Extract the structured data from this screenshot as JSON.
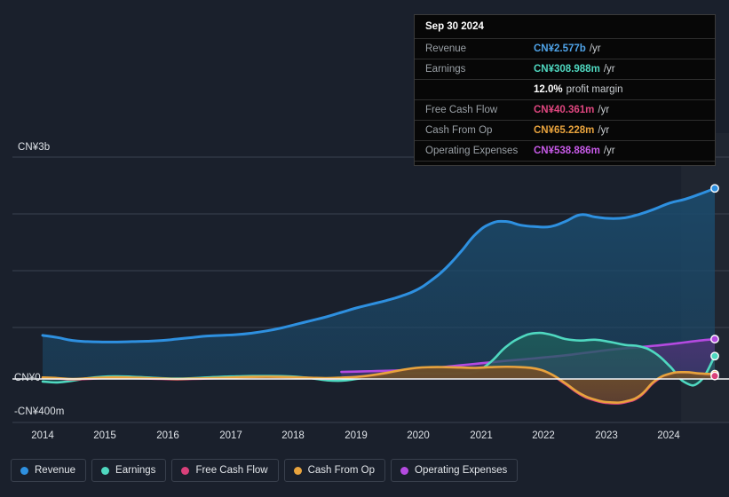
{
  "chart_data": {
    "type": "area",
    "title": "",
    "xlabel": "",
    "ylabel": "",
    "currency": "CN¥",
    "grid": true,
    "legend_position": "bottom",
    "x": [
      2014,
      2015,
      2016,
      2017,
      2018,
      2019,
      2020,
      2021,
      2022,
      2023,
      2024
    ],
    "xlim": [
      2013.7,
      2024.85
    ],
    "ylim": [
      -400000000,
      3000000000
    ],
    "y_ticks": [
      {
        "label": "CN¥3b",
        "value": 3000000000
      },
      {
        "label": "CN¥0",
        "value": 0
      },
      {
        "label": "-CN¥400m",
        "value": -400000000
      }
    ],
    "x_ticks": [
      "2014",
      "2015",
      "2016",
      "2017",
      "2018",
      "2019",
      "2020",
      "2021",
      "2022",
      "2023",
      "2024"
    ],
    "series": [
      {
        "name": "Revenue",
        "color": "#2e90e0",
        "fill": "#1b4a6b",
        "values": [
          590,
          560,
          520,
          505,
          500,
          500,
          505,
          510,
          520,
          540,
          560,
          580,
          590,
          600,
          620,
          650,
          690,
          740,
          790,
          840,
          900,
          960,
          1010,
          1060,
          1120,
          1200,
          1330,
          1500,
          1720,
          1960,
          2100,
          2130,
          2080,
          2060,
          2060,
          2130,
          2220,
          2190,
          2170,
          2180,
          2230,
          2300,
          2380,
          2430,
          2500,
          2577
        ]
      },
      {
        "name": "Earnings",
        "color": "#4fd8c0",
        "fill": "#1f5b5a",
        "values": [
          -30,
          -40,
          -20,
          10,
          30,
          35,
          30,
          20,
          10,
          5,
          10,
          20,
          30,
          35,
          40,
          40,
          38,
          30,
          10,
          -15,
          -20,
          0,
          30,
          60,
          75,
          80,
          78,
          75,
          80,
          100,
          230,
          430,
          560,
          620,
          600,
          540,
          520,
          530,
          500,
          460,
          440,
          350,
          170,
          -40,
          -30,
          309
        ]
      },
      {
        "name": "Free Cash Flow",
        "color": "#d9407a",
        "fill": "#6b2d4c",
        "values": [
          10,
          5,
          -5,
          0,
          10,
          15,
          10,
          5,
          0,
          -5,
          0,
          5,
          10,
          15,
          20,
          22,
          20,
          15,
          10,
          5,
          10,
          20,
          40,
          70,
          110,
          140,
          150,
          150,
          145,
          140,
          150,
          155,
          150,
          130,
          60,
          -60,
          -180,
          -250,
          -280,
          -270,
          -200,
          -30,
          60,
          80,
          60,
          40
        ]
      },
      {
        "name": "Cash From Op",
        "color": "#e8a33d",
        "fill": "#6b5226",
        "values": [
          20,
          12,
          0,
          8,
          18,
          22,
          18,
          12,
          6,
          0,
          5,
          10,
          16,
          22,
          28,
          30,
          28,
          22,
          16,
          12,
          18,
          28,
          50,
          82,
          120,
          150,
          160,
          160,
          155,
          150,
          160,
          165,
          160,
          140,
          70,
          -50,
          -170,
          -240,
          -270,
          -260,
          -190,
          -20,
          72,
          92,
          74,
          65
        ]
      },
      {
        "name": "Operating Expenses",
        "color": "#b44ae0",
        "fill": "#4b3474",
        "start_index": 20,
        "values": [
          null,
          null,
          null,
          null,
          null,
          null,
          null,
          null,
          null,
          null,
          null,
          null,
          null,
          null,
          null,
          null,
          null,
          null,
          null,
          null,
          95,
          100,
          105,
          110,
          118,
          130,
          148,
          165,
          185,
          205,
          225,
          245,
          262,
          280,
          300,
          320,
          345,
          370,
          395,
          415,
          430,
          450,
          470,
          495,
          520,
          539
        ]
      }
    ],
    "highlight_band": {
      "from": 2023.5,
      "label": ""
    },
    "end_markers": [
      {
        "series": "Revenue",
        "value": 2577000000
      },
      {
        "series": "Operating Expenses",
        "value": 538886000
      },
      {
        "series": "Earnings",
        "value": 308988000
      },
      {
        "series": "Cash From Op",
        "value": 65228000
      },
      {
        "series": "Free Cash Flow",
        "value": 40361000
      }
    ]
  },
  "tooltip": {
    "date": "Sep 30 2024",
    "rows": [
      {
        "label": "Revenue",
        "value": "CN¥2.577b",
        "unit": "/yr",
        "color": "#4fa3e8"
      },
      {
        "label": "Earnings",
        "value": "CN¥308.988m",
        "unit": "/yr",
        "color": "#4fd8c0"
      },
      {
        "label": "",
        "value": "12.0%",
        "unit": "profit margin",
        "color": "#ffffff"
      },
      {
        "label": "Free Cash Flow",
        "value": "CN¥40.361m",
        "unit": "/yr",
        "color": "#e0467f"
      },
      {
        "label": "Cash From Op",
        "value": "CN¥65.228m",
        "unit": "/yr",
        "color": "#e8a33d"
      },
      {
        "label": "Operating Expenses",
        "value": "CN¥538.886m",
        "unit": "/yr",
        "color": "#c75ae8"
      }
    ]
  },
  "legend": {
    "items": [
      {
        "label": "Revenue",
        "color": "#2e90e0"
      },
      {
        "label": "Earnings",
        "color": "#4fd8c0"
      },
      {
        "label": "Free Cash Flow",
        "color": "#d9407a"
      },
      {
        "label": "Cash From Op",
        "color": "#e8a33d"
      },
      {
        "label": "Operating Expenses",
        "color": "#b44ae0"
      }
    ]
  },
  "axis": {
    "y_labels": [
      "CN¥3b",
      "CN¥0",
      "-CN¥400m"
    ],
    "x_labels": [
      "2014",
      "2015",
      "2016",
      "2017",
      "2018",
      "2019",
      "2020",
      "2021",
      "2022",
      "2023",
      "2024"
    ]
  }
}
